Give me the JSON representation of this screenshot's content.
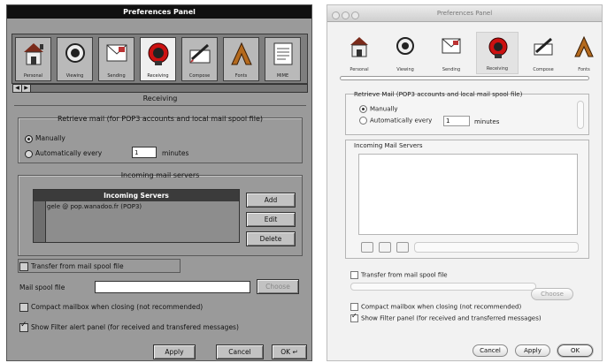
{
  "left_panel": {
    "title": "Preferences Panel",
    "toolbar": [
      {
        "label": "Personal"
      },
      {
        "label": "Viewing"
      },
      {
        "label": "Sending"
      },
      {
        "label": "Receiving"
      },
      {
        "label": "Compose"
      },
      {
        "label": "Fonts"
      },
      {
        "label": "MIME"
      }
    ],
    "section_title": "Receiving",
    "retrieve_group": {
      "title": "Retrieve mail (for POP3 accounts and local mail spool file)",
      "manually_label": "Manually",
      "auto_label": "Automatically every",
      "interval_value": "1",
      "minutes_label": "minutes"
    },
    "incoming_group": {
      "title": "Incoming mail servers",
      "list_header": "Incoming Servers",
      "servers": [
        "gele @ pop.wanadoo.fr (POP3)"
      ],
      "add_label": "Add",
      "edit_label": "Edit",
      "delete_label": "Delete"
    },
    "transfer_label": "Transfer from mail spool file",
    "spool_label": "Mail spool file",
    "spool_value": "",
    "choose_label": "Choose",
    "compact_label": "Compact mailbox when closing (not recommended)",
    "filter_label": "Show Filter alert panel (for received and transfered messages)",
    "apply_label": "Apply",
    "cancel_label": "Cancel",
    "ok_label": "OK"
  },
  "right_panel": {
    "title": "Preferences Panel",
    "toolbar": [
      {
        "label": "Personal"
      },
      {
        "label": "Viewing"
      },
      {
        "label": "Sending"
      },
      {
        "label": "Receiving"
      },
      {
        "label": "Compose"
      },
      {
        "label": "Fonts"
      }
    ],
    "retrieve_group": {
      "title": "Retrieve Mail (POP3 accounts and local mail spool file)",
      "manually_label": "Manually",
      "auto_label": "Automatically every",
      "interval_value": "1",
      "minutes_label": "minutes"
    },
    "incoming_title": "Incoming Mail Servers",
    "transfer_label": "Transfer from mail spool file",
    "choose_label": "Choose",
    "compact_label": "Compact mailbox when closing (not recommended)",
    "filter_label": "Show Filter panel (for received and transferred messages)",
    "cancel_label": "Cancel",
    "apply_label": "Apply",
    "ok_label": "OK"
  }
}
